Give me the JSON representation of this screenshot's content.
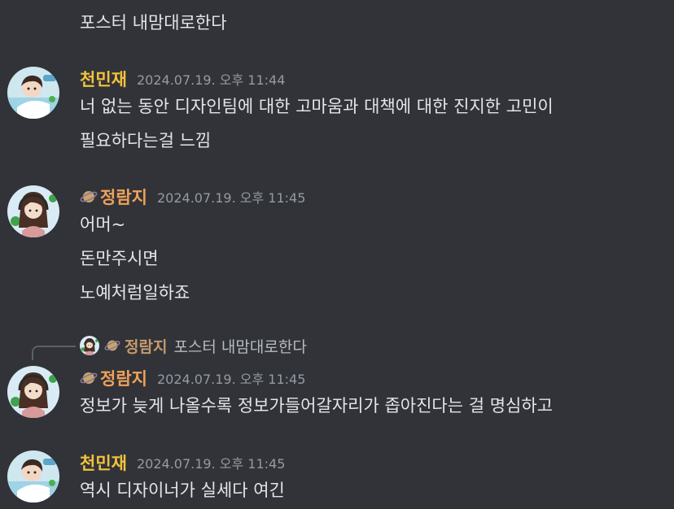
{
  "messages": {
    "m0": {
      "lines": [
        "포스터 내맘대로한다"
      ]
    },
    "m1": {
      "author": "천민재",
      "timestamp": "2024.07.19. 오후 11:44",
      "lines": [
        "너 없는 동안 디자인팀에 대한 고마움과 대책에 대한 진지한 고민이",
        "필요하다는걸 느낌"
      ]
    },
    "m2": {
      "author": "정람지",
      "timestamp": "2024.07.19. 오후 11:45",
      "lines": [
        "어머~",
        "돈만주시면",
        "노예처럼일하죠"
      ]
    },
    "m3": {
      "reply": {
        "author": "정람지",
        "text": "포스터 내맘대로한다"
      },
      "author": "정람지",
      "timestamp": "2024.07.19. 오후 11:45",
      "lines": [
        "정보가 늦게 나올수록 정보가들어갈자리가 좁아진다는 걸 명심하고"
      ]
    },
    "m4": {
      "author": "천민재",
      "timestamp": "2024.07.19. 오후 11:45",
      "lines": [
        "역시 디자이너가 실세다 여긴"
      ]
    }
  },
  "colors": {
    "background": "#313338",
    "name_yellow": "#f0c23b",
    "name_orange": "#f0a25a",
    "timestamp": "#949ba4"
  },
  "icons": {
    "planet_badge": "planet-icon"
  }
}
